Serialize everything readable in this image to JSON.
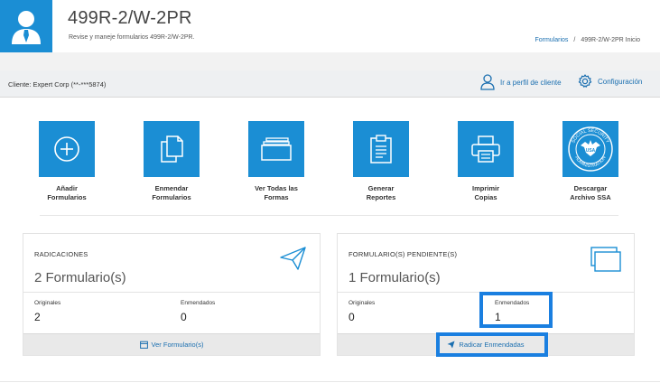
{
  "header": {
    "title": "499R-2/W-2PR",
    "subtitle": "Revise y maneje formularios 499R-2/W-2PR.",
    "breadcrumb": {
      "link": "Formularios",
      "separator": "/",
      "current": "499R-2/W-2PR Inicio"
    }
  },
  "client_bar": {
    "client_label": "Cliente: Expert Corp (**-***5874)",
    "profile_link": "Ir a perfil de cliente",
    "config_link": "Configuración"
  },
  "tiles": [
    {
      "label": "Añadir\nFormularios",
      "icon": "plus-circle-icon"
    },
    {
      "label": "Enmendar\nFormularios",
      "icon": "documents-icon"
    },
    {
      "label": "Ver Todas las\nFormas",
      "icon": "folder-stack-icon"
    },
    {
      "label": "Generar\nReportes",
      "icon": "clipboard-icon"
    },
    {
      "label": "Imprimir\nCopias",
      "icon": "printer-icon"
    },
    {
      "label": "Descargar\nArchivo SSA",
      "icon": "ssa-seal-icon"
    }
  ],
  "seal_text": {
    "top": "SOCIAL SECURITY",
    "bottom": "ADMINISTRATION",
    "center": "USA"
  },
  "cards": {
    "radicaciones": {
      "title": "RADICACIONES",
      "count": "2 Formulario(s)",
      "originales_label": "Originales",
      "originales_value": "2",
      "enmendados_label": "Enmendados",
      "enmendados_value": "0",
      "footer": "Ver Formulario(s)"
    },
    "pendientes": {
      "title": "FORMULARIO(S) PENDIENTE(S)",
      "count": "1 Formulario(s)",
      "originales_label": "Originales",
      "originales_value": "0",
      "enmendados_label": "Enmendados",
      "enmendados_value": "1",
      "footer": "Radicar Enmendadas"
    }
  },
  "colors": {
    "accent": "#1b8ed4",
    "link": "#1b6fb0",
    "highlight": "#1a7fe0"
  }
}
